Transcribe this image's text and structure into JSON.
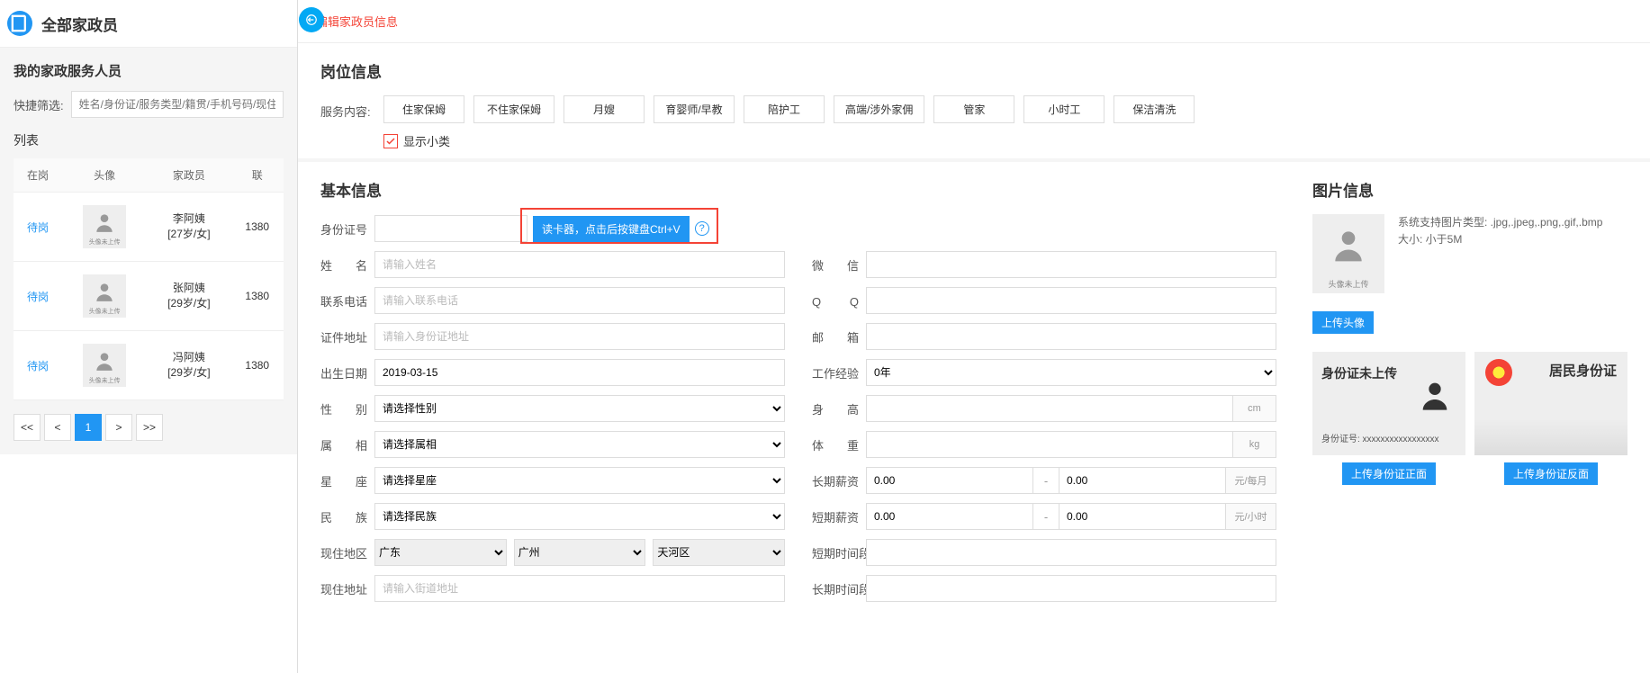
{
  "left": {
    "title": "全部家政员",
    "subtitle": "我的家政服务人员",
    "filter_label": "快捷筛选:",
    "filter_placeholder": "姓名/身份证/服务类型/籍贯/手机号码/现住地",
    "list_label": "列表",
    "columns": {
      "c1": "在岗",
      "c2": "头像",
      "c3": "家政员",
      "c4": "联"
    },
    "rows": [
      {
        "status": "待岗",
        "name": "李阿姨",
        "meta": "[27岁/女]",
        "phone": "1380",
        "avatar_text": "头像未上传"
      },
      {
        "status": "待岗",
        "name": "张阿姨",
        "meta": "[29岁/女]",
        "phone": "1380",
        "avatar_text": "头像未上传"
      },
      {
        "status": "待岗",
        "name": "冯阿姨",
        "meta": "[29岁/女]",
        "phone": "1380",
        "avatar_text": "头像未上传"
      }
    ],
    "pager": {
      "first": "<<",
      "prev": "<",
      "p1": "1",
      "next": ">",
      "last": ">>"
    }
  },
  "right": {
    "edit_title": "编辑家政员信息",
    "post_section": "岗位信息",
    "service_label": "服务内容:",
    "chips": [
      "住家保姆",
      "不住家保姆",
      "月嫂",
      "育婴师/早教",
      "陪护工",
      "高端/涉外家佣",
      "管家",
      "小时工",
      "保洁清洗"
    ],
    "show_sub": "显示小类",
    "basic_section": "基本信息",
    "image_section": "图片信息",
    "labels": {
      "id": "身份证号",
      "name": "姓　名",
      "phone": "联系电话",
      "id_addr": "证件地址",
      "dob": "出生日期",
      "gender": "性　别",
      "zodiac": "属　相",
      "star": "星　座",
      "ethnic": "民　族",
      "region": "现住地区",
      "addr": "现住地址",
      "wechat": "微　信",
      "qq": "Q　Q",
      "email": "邮　箱",
      "exp": "工作经验",
      "height": "身　高",
      "weight": "体　重",
      "long_salary": "长期薪资",
      "short_salary": "短期薪资",
      "short_time": "短期时间段",
      "long_time": "长期时间段"
    },
    "card_reader_btn": "读卡器，点击后按键盘Ctrl+V",
    "placeholders": {
      "name": "请输入姓名",
      "phone": "请输入联系电话",
      "id_addr": "请输入身份证地址",
      "addr": "请输入街道地址"
    },
    "values": {
      "dob": "2019-03-15",
      "exp": "0年",
      "gender": "请选择性别",
      "zodiac": "请选择属相",
      "star": "请选择星座",
      "ethnic": "请选择民族",
      "prov": "广东",
      "city": "广州",
      "dist": "天河区",
      "salary_a": "0.00",
      "salary_b": "0.00",
      "salary_unit_m": "元/每月",
      "salary_unit_h": "元/小时",
      "cm": "cm",
      "kg": "kg"
    },
    "image_info": {
      "avatar_text": "头像未上传",
      "type_hint": "系统支持图片类型: .jpg,.jpeg,.png,.gif,.bmp",
      "size_hint": "大小: 小于5M",
      "upload_avatar": "上传头像",
      "id_front_label": "身份证未上传",
      "id_num_label": "身份证号: xxxxxxxxxxxxxxxxx",
      "id_back_title": "居民身份证",
      "upload_front": "上传身份证正面",
      "upload_back": "上传身份证反面"
    }
  }
}
